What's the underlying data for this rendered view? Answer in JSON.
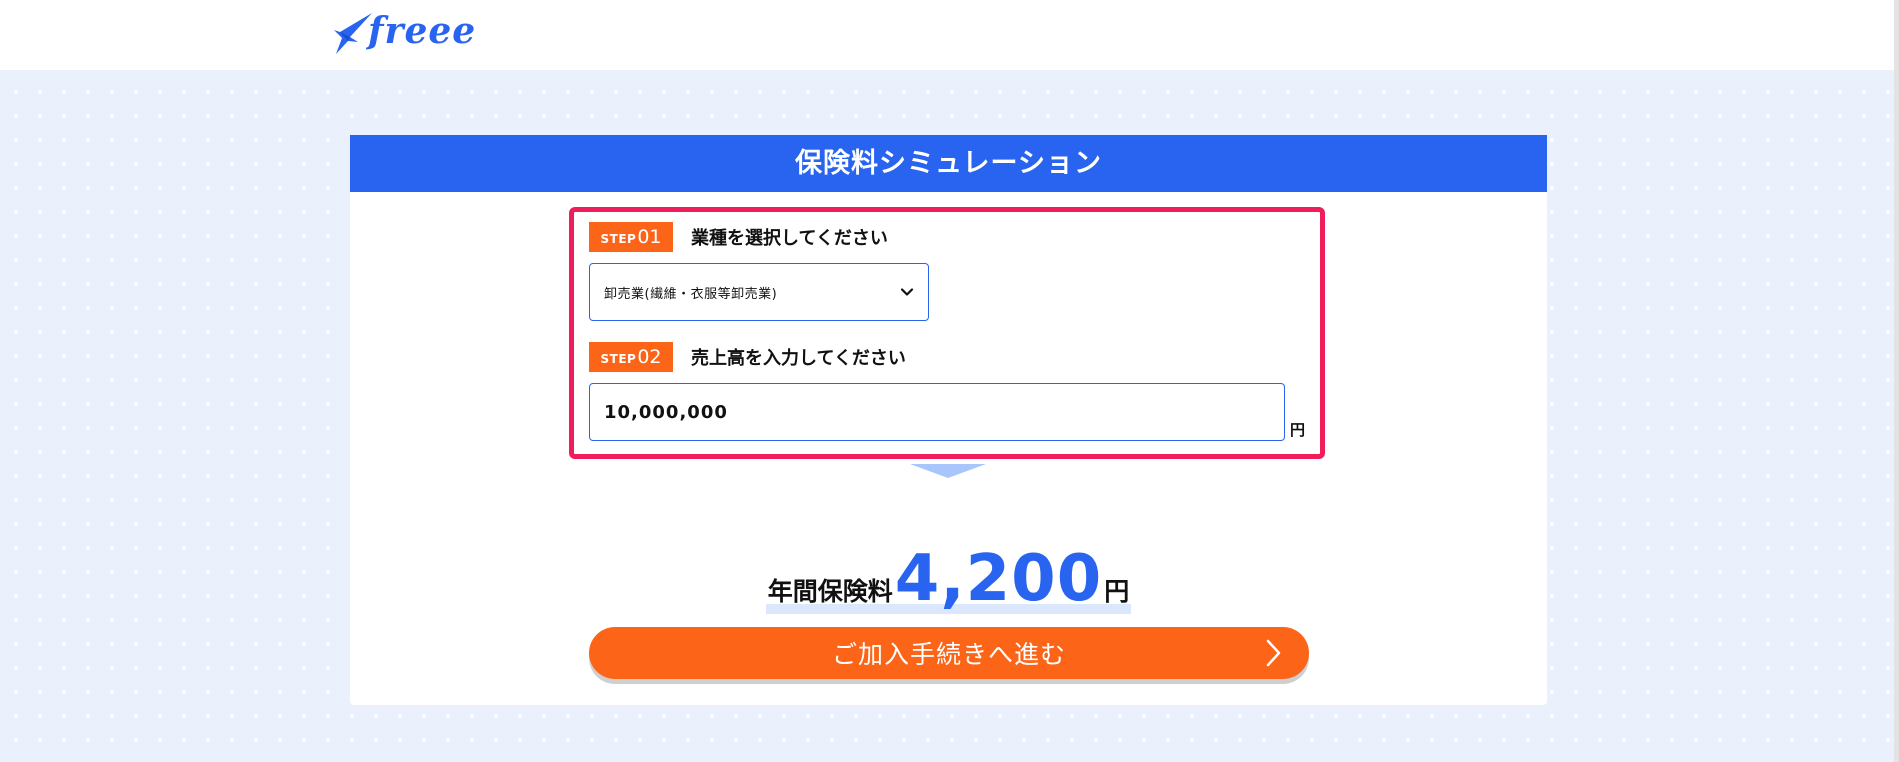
{
  "header": {
    "logo_text": "freee"
  },
  "simulator": {
    "title": "保険料シミュレーション",
    "step1": {
      "badge_word": "STEP",
      "badge_num": "01",
      "label": "業種を選択してください",
      "selected_value": "卸売業(繊維・衣服等卸売業)"
    },
    "step2": {
      "badge_word": "STEP",
      "badge_num": "02",
      "label": "売上高を入力してください",
      "value": "10,000,000",
      "unit": "円"
    },
    "result": {
      "label": "年間保険料",
      "amount": "4,200",
      "unit": "円"
    },
    "cta_label": "ご加入手続きへ進む"
  },
  "colors": {
    "brand_blue": "#2864f0",
    "accent_orange": "#fc6418",
    "highlight_pink": "#ef1e5a",
    "background": "#eaf1fd"
  },
  "icons": {
    "logo": "freee-bird-icon",
    "select": "chevron-down-icon",
    "cta": "chevron-right-icon"
  }
}
